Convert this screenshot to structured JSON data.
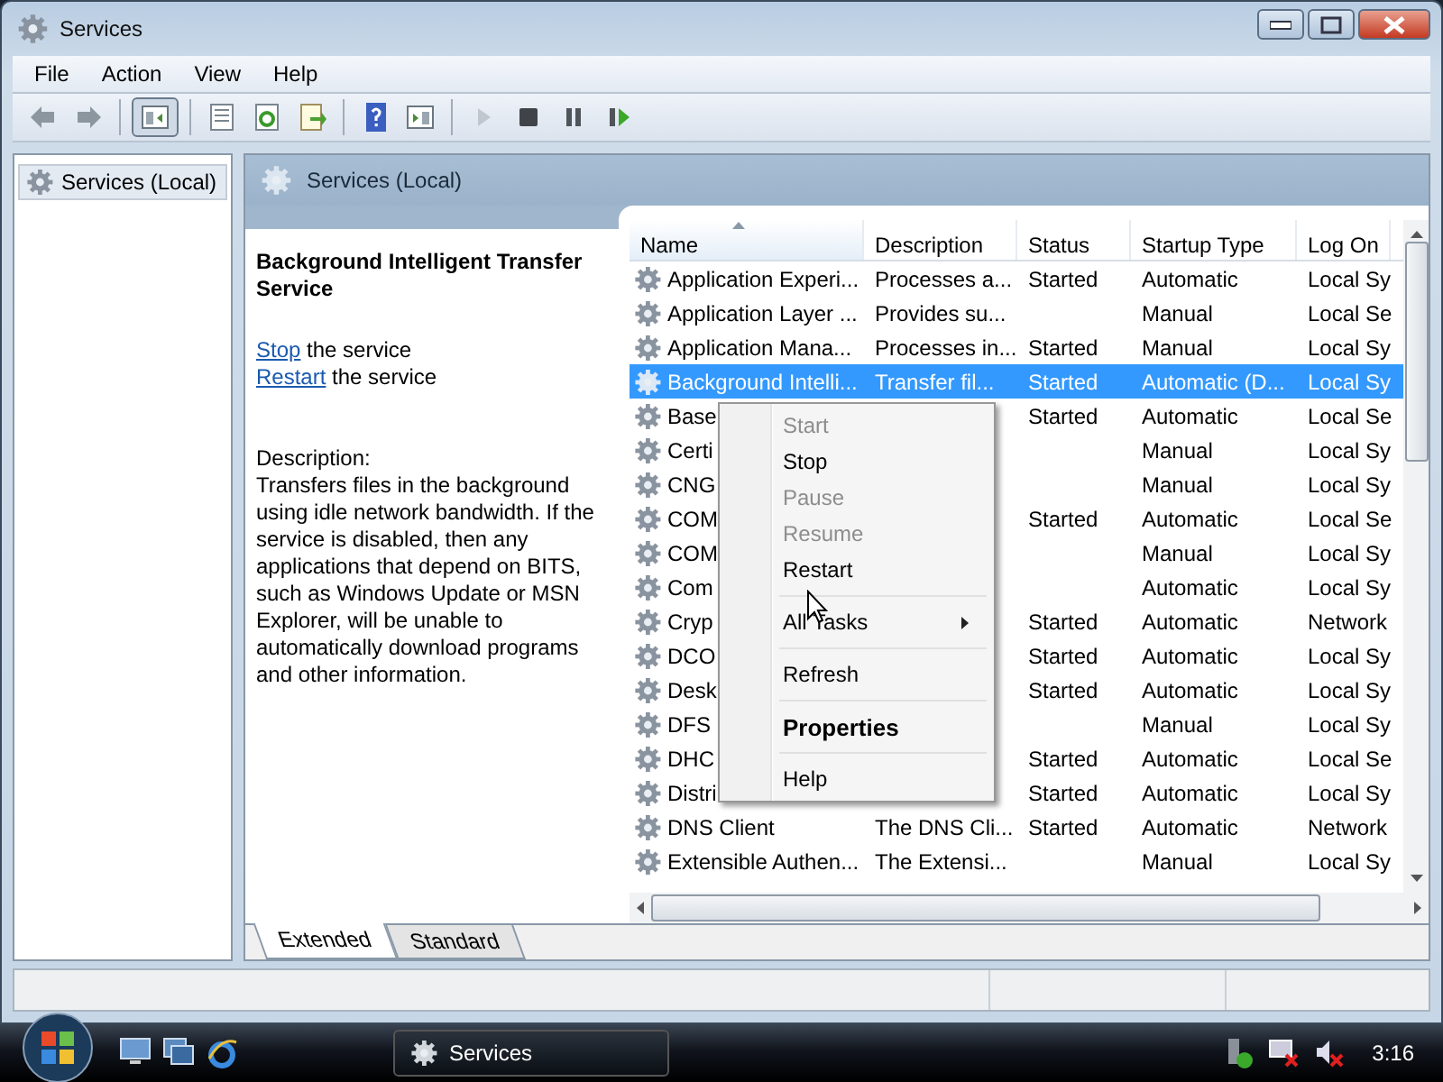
{
  "window": {
    "title": "Services"
  },
  "menu_bar": [
    {
      "label": "File"
    },
    {
      "label": "Action"
    },
    {
      "label": "View"
    },
    {
      "label": "Help"
    }
  ],
  "toolbar": [
    {
      "kind": "back",
      "disabled": false,
      "pressed": false
    },
    {
      "kind": "forward",
      "disabled": false,
      "pressed": false
    },
    {
      "kind": "separator"
    },
    {
      "kind": "tree",
      "disabled": false,
      "pressed": true
    },
    {
      "kind": "separator"
    },
    {
      "kind": "properties",
      "disabled": false,
      "pressed": false
    },
    {
      "kind": "refresh",
      "disabled": false,
      "pressed": false
    },
    {
      "kind": "export",
      "disabled": false,
      "pressed": false
    },
    {
      "kind": "separator"
    },
    {
      "kind": "help",
      "disabled": false,
      "pressed": false
    },
    {
      "kind": "pane",
      "disabled": false,
      "pressed": false
    },
    {
      "kind": "separator"
    },
    {
      "kind": "play",
      "disabled": true,
      "pressed": false
    },
    {
      "kind": "stop",
      "disabled": false,
      "pressed": false
    },
    {
      "kind": "pause",
      "disabled": false,
      "pressed": false
    },
    {
      "kind": "resume",
      "disabled": false,
      "pressed": false
    }
  ],
  "tree": {
    "items": [
      {
        "label": "Services (Local)",
        "selected": true
      }
    ]
  },
  "header": {
    "title": "Services (Local)"
  },
  "detail": {
    "service_name": "Background Intelligent Transfer Service",
    "actions": [
      {
        "link": "Stop",
        "text": "the service"
      },
      {
        "link": "Restart",
        "text": "the service"
      }
    ],
    "description_label": "Description:",
    "description": "Transfers files in the background using idle network bandwidth. If the service is disabled, then any applications that depend on BITS, such as Windows Update or MSN Explorer, will be unable to automatically download programs and other information."
  },
  "table": {
    "columns": [
      {
        "label": "Name",
        "sorted": true
      },
      {
        "label": "Description",
        "sorted": false
      },
      {
        "label": "Status",
        "sorted": false
      },
      {
        "label": "Startup Type",
        "sorted": false
      },
      {
        "label": "Log On",
        "sorted": false
      }
    ],
    "rows": [
      {
        "name": "Application Experi...",
        "description": "Processes a...",
        "status": "Started",
        "startup_type": "Automatic",
        "log_on": "Local Sy",
        "selected": false
      },
      {
        "name": "Application Layer ...",
        "description": "Provides su...",
        "startup_type": "Manual",
        "log_on": "Local Se",
        "selected": false
      },
      {
        "name": "Application Mana...",
        "description": "Processes in...",
        "status": "Started",
        "startup_type": "Manual",
        "log_on": "Local Sy",
        "selected": false
      },
      {
        "name": "Background Intelli...",
        "description": "Transfer fil...",
        "status": "Started",
        "startup_type": "Automatic (D...",
        "log_on": "Local Sy",
        "selected": true
      },
      {
        "name": "Base",
        "status": "Started",
        "startup_type": "Automatic",
        "log_on": "Local Se",
        "selected": false
      },
      {
        "name": "Certi",
        "startup_type": "Manual",
        "log_on": "Local Sy",
        "selected": false
      },
      {
        "name": "CNG",
        "startup_type": "Manual",
        "log_on": "Local Sy",
        "selected": false
      },
      {
        "name": "COM",
        "status": "Started",
        "startup_type": "Automatic",
        "log_on": "Local Se",
        "selected": false
      },
      {
        "name": "COM",
        "startup_type": "Manual",
        "log_on": "Local Sy",
        "selected": false
      },
      {
        "name": "Com",
        "startup_type": "Automatic",
        "log_on": "Local Sy",
        "selected": false
      },
      {
        "name": "Cryp",
        "status": "Started",
        "startup_type": "Automatic",
        "log_on": "Network",
        "selected": false
      },
      {
        "name": "DCO",
        "status": "Started",
        "startup_type": "Automatic",
        "log_on": "Local Sy",
        "selected": false
      },
      {
        "name": "Desk",
        "status": "Started",
        "startup_type": "Automatic",
        "log_on": "Local Sy",
        "selected": false
      },
      {
        "name": "DFS",
        "startup_type": "Manual",
        "log_on": "Local Sy",
        "selected": false
      },
      {
        "name": "DHC",
        "status": "Started",
        "startup_type": "Automatic",
        "log_on": "Local Se",
        "selected": false
      },
      {
        "name": "Distri",
        "status": "Started",
        "startup_type": "Automatic",
        "log_on": "Local Sy",
        "selected": false
      },
      {
        "name": "DNS Client",
        "description": "The DNS Cli...",
        "status": "Started",
        "startup_type": "Automatic",
        "log_on": "Network",
        "selected": false
      },
      {
        "name": "Extensible Authen...",
        "description": "The Extensi...",
        "startup_type": "Manual",
        "log_on": "Local Sy",
        "selected": false
      }
    ]
  },
  "view_tabs": [
    {
      "label": "Extended",
      "selected": true
    },
    {
      "label": "Standard",
      "selected": false
    }
  ],
  "context_menu": {
    "items": [
      {
        "kind": "item",
        "label": "Start",
        "disabled": true,
        "default": false
      },
      {
        "kind": "item",
        "label": "Stop",
        "disabled": false,
        "default": false
      },
      {
        "kind": "item",
        "label": "Pause",
        "disabled": true,
        "default": false
      },
      {
        "kind": "item",
        "label": "Resume",
        "disabled": true,
        "default": false
      },
      {
        "kind": "item",
        "label": "Restart",
        "disabled": false,
        "default": false
      },
      {
        "kind": "separator"
      },
      {
        "kind": "submenu",
        "label": "All Tasks",
        "disabled": false,
        "default": false
      },
      {
        "kind": "separator"
      },
      {
        "kind": "item",
        "label": "Refresh",
        "disabled": false,
        "default": false
      },
      {
        "kind": "separator"
      },
      {
        "kind": "item",
        "label": "Properties",
        "disabled": false,
        "default": true
      },
      {
        "kind": "separator"
      },
      {
        "kind": "item",
        "label": "Help",
        "disabled": false,
        "default": false
      }
    ]
  },
  "taskbar": {
    "tasks": [
      {
        "label": "Services",
        "selected": false
      }
    ],
    "clock": "3:16"
  }
}
